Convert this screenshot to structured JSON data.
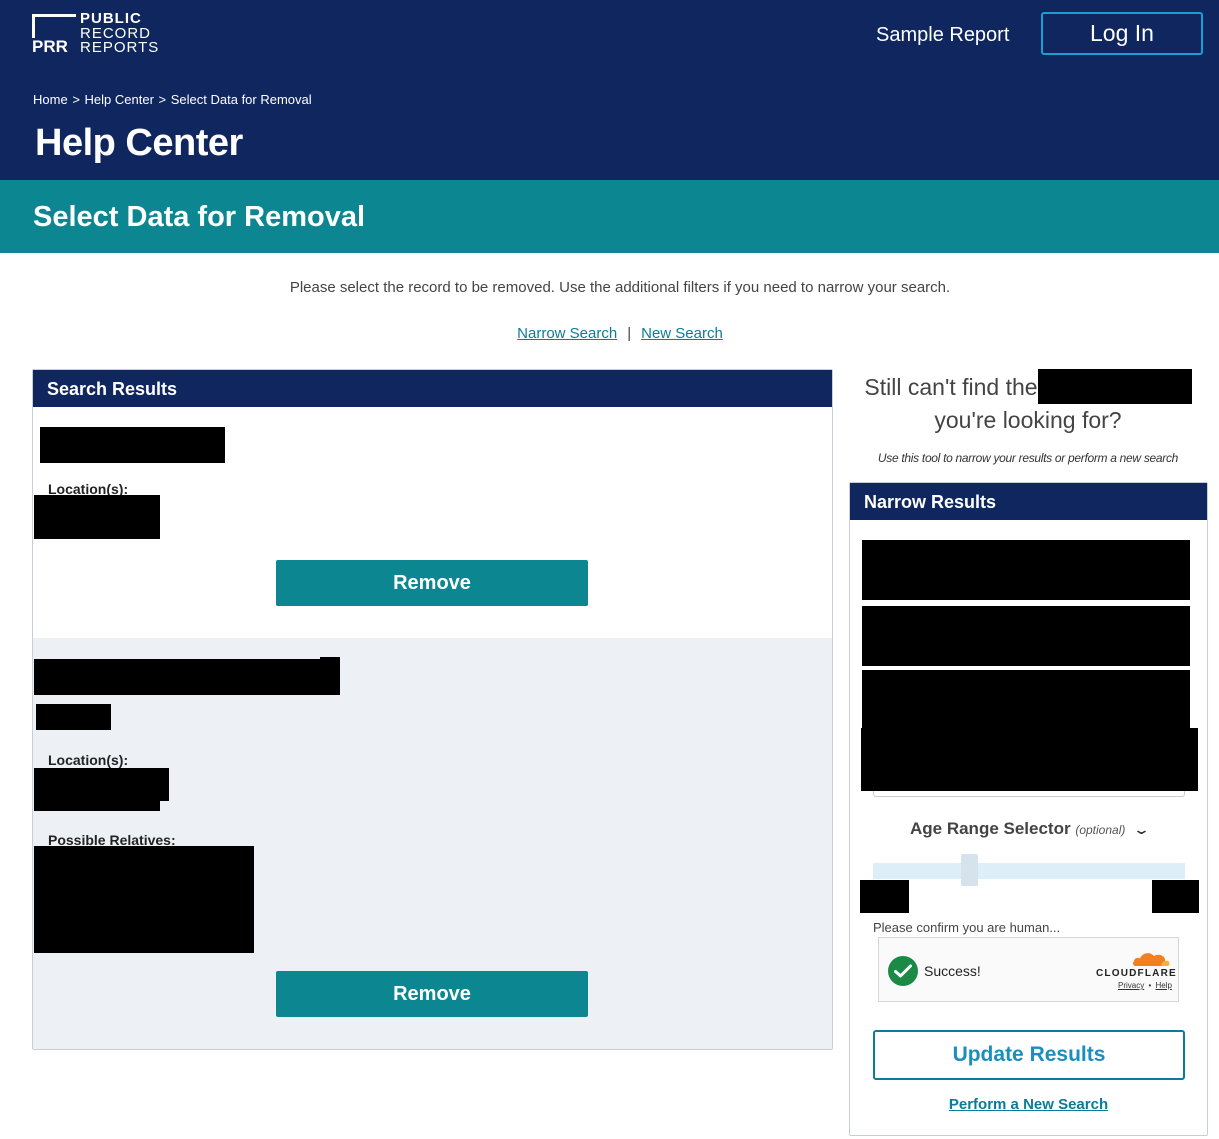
{
  "header": {
    "logo_mark": "PRR",
    "logo_lines": [
      "PUBLIC",
      "RECORD",
      "REPORTS"
    ],
    "sample_report": "Sample Report",
    "login": "Log In"
  },
  "breadcrumb": {
    "home": "Home",
    "sep1": ">",
    "help_center": "Help Center",
    "sep2": ">",
    "current": "Select Data for Removal"
  },
  "page_title": "Help Center",
  "section_title": "Select Data for Removal",
  "intro": "Please select the record to be removed. Use the additional filters if you need to narrow your search.",
  "links": {
    "narrow": "Narrow Search",
    "separator": "|",
    "new": "New Search"
  },
  "results": {
    "heading": "Search Results",
    "records": [
      {
        "location_label": "Location(s):",
        "remove_label": "Remove"
      },
      {
        "location_label": "Location(s):",
        "relatives_label": "Possible Relatives:",
        "remove_label": "Remove"
      }
    ]
  },
  "sidebar": {
    "still_line1": "Still can't find the",
    "still_line2": "you're looking for?",
    "subtitle": "Use this tool to narrow your results or perform a new search",
    "narrow_heading": "Narrow Results",
    "age_label": "Age Range Selector",
    "age_optional": "(optional)",
    "confirm_text": "Please confirm you are human...",
    "captcha": {
      "status": "Success!",
      "brand": "CLOUDFLARE",
      "privacy": "Privacy",
      "dot": "•",
      "help": "Help"
    },
    "update_button": "Update Results",
    "new_search_link": "Perform a New Search"
  },
  "colors": {
    "navy": "#10265e",
    "teal": "#0c8690",
    "link": "#0a7c98",
    "success_green": "#1b8a46",
    "cloudflare_orange": "#f38020"
  },
  "icons": [
    "chevron-down-icon",
    "checkmark-icon",
    "cloudflare-cloud-icon"
  ]
}
